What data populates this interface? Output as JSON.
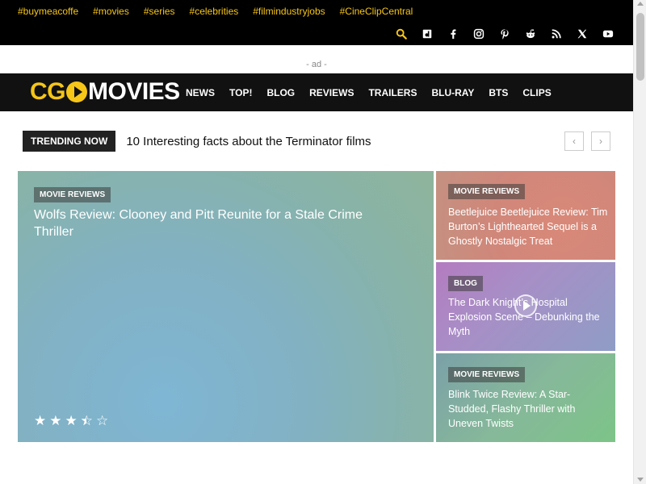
{
  "topbar": {
    "tags": [
      "#buymeacoffe",
      "#movies",
      "#series",
      "#celebrities",
      "#filmindustryjobs",
      "#CineClipCentral"
    ],
    "socials": [
      "search-icon",
      "dlvr-icon",
      "facebook-icon",
      "instagram-icon",
      "pinterest-icon",
      "reddit-icon",
      "rss-icon",
      "x-icon",
      "youtube-icon"
    ]
  },
  "ad": {
    "label": "- ad -"
  },
  "logo": {
    "part1": "CG",
    "part2": "MOVIES"
  },
  "menu": [
    "NEWS",
    "TOP!",
    "BLOG",
    "REVIEWS",
    "TRAILERS",
    "BLU-RAY",
    "BTS",
    "CLIPS"
  ],
  "trending": {
    "label": "TRENDING NOW",
    "headline": "10 Interesting facts about the Terminator films",
    "prev": "‹",
    "next": "›"
  },
  "featured": {
    "main": {
      "category": "MOVIE REVIEWS",
      "title": "Wolfs Review: Clooney and Pitt Reunite for a Stale Crime Thriller",
      "rating": 3.5
    },
    "side": [
      {
        "category": "MOVIE REVIEWS",
        "title": "Beetlejuice Beetlejuice Review: Tim Burton’s Lighthearted Sequel is a Ghostly Nostalgic Treat"
      },
      {
        "category": "BLOG",
        "title": "The Dark Knight’s Hospital Explosion Scene – Debunking the Myth"
      },
      {
        "category": "MOVIE REVIEWS",
        "title": "Blink Twice Review: A Star-Studded, Flashy Thriller with Uneven Twists"
      }
    ]
  },
  "colors": {
    "accent": "#f5c518",
    "nav_bg": "#111111",
    "top_bg": "#000000"
  }
}
